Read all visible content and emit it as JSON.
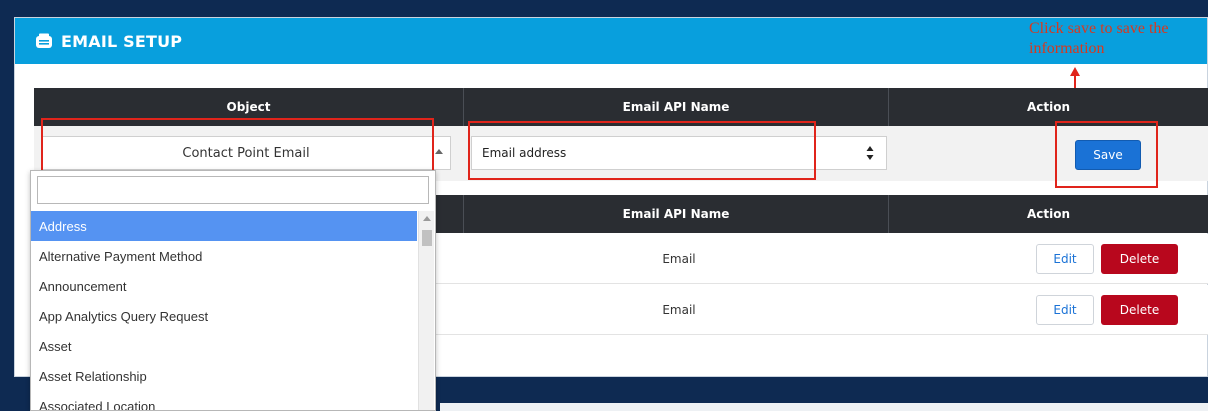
{
  "panel": {
    "title": "EMAIL SETUP"
  },
  "annotation": {
    "text": "Click save to save the information"
  },
  "form_table": {
    "headers": [
      "Object",
      "Email API Name",
      "Action"
    ],
    "object_value": "Contact Point Email",
    "email_value": "Email address",
    "save_label": "Save"
  },
  "records_table": {
    "headers": [
      "",
      "Email API Name",
      "Action"
    ],
    "rows": [
      {
        "email_api": "Email",
        "edit_label": "Edit",
        "delete_label": "Delete"
      },
      {
        "email_api": "Email",
        "edit_label": "Edit",
        "delete_label": "Delete"
      }
    ]
  },
  "dropdown": {
    "search_value": "",
    "items": [
      "Address",
      "Alternative Payment Method",
      "Announcement",
      "App Analytics Query Request",
      "Asset",
      "Asset Relationship",
      "Associated Location"
    ],
    "selected": "Address"
  },
  "colors": {
    "header_blue": "#089fdd",
    "table_header": "#2a2d32",
    "save_blue": "#1a72d6",
    "delete_red": "#b8071d",
    "highlight_red": "#e0241b",
    "selected_item": "#5593f2",
    "page_bg": "#0e2a52"
  },
  "icons": [
    "email-setup-icon",
    "arrow-up-icon",
    "caret-up-icon",
    "spinner-icon",
    "scroll-up-icon"
  ]
}
